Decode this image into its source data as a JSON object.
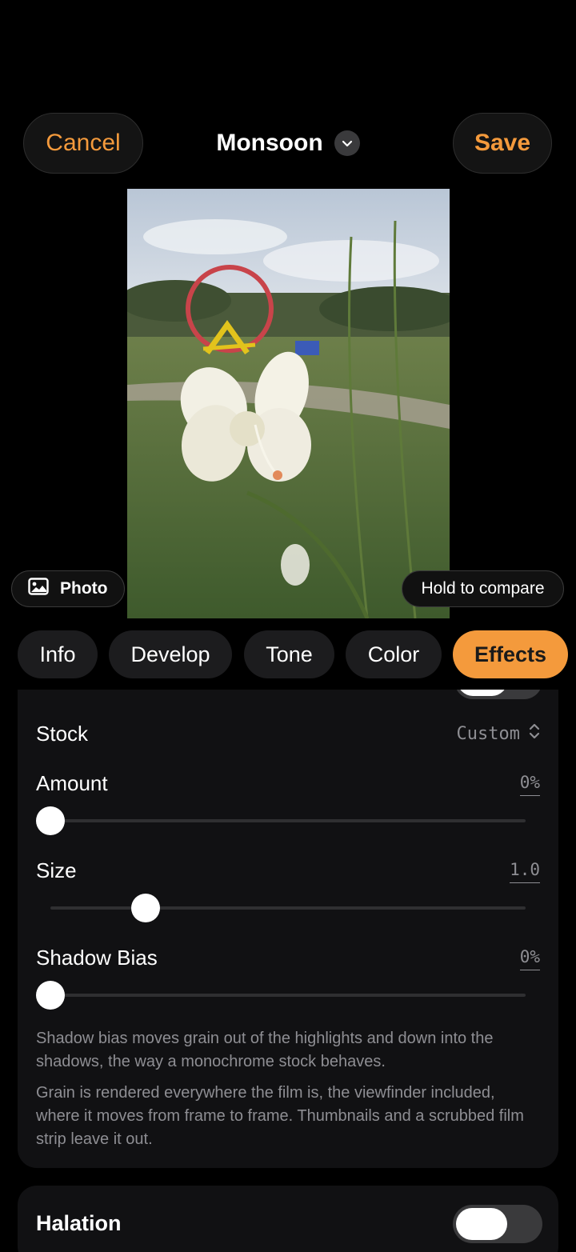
{
  "header": {
    "cancel_label": "Cancel",
    "title": "Monsoon",
    "save_label": "Save"
  },
  "photo_chip": {
    "label": "Photo"
  },
  "compare_chip": {
    "label": "Hold to compare"
  },
  "tabs": [
    {
      "label": "Info",
      "active": false
    },
    {
      "label": "Develop",
      "active": false
    },
    {
      "label": "Tone",
      "active": false
    },
    {
      "label": "Color",
      "active": false
    },
    {
      "label": "Effects",
      "active": true
    }
  ],
  "grain": {
    "stock_label": "Stock",
    "stock_value": "Custom",
    "amount_label": "Amount",
    "amount_value": "0%",
    "amount_level": 0.0,
    "size_label": "Size",
    "size_value": "1.0",
    "size_level": 0.2,
    "shadow_bias_label": "Shadow Bias",
    "shadow_bias_value": "0%",
    "shadow_bias_level": 0.0,
    "note_1": "Shadow bias moves grain out of the highlights and down into the shadows, the way a monochrome stock behaves.",
    "note_2": "Grain is rendered everywhere the film is, the viewfinder included, where it moves from frame to frame. Thumbnails and a scrubbed film strip leave it out."
  },
  "halation": {
    "label": "Halation",
    "enabled": true
  },
  "colors": {
    "accent": "#f49a3c",
    "background": "#000000",
    "panel": "#111113"
  }
}
